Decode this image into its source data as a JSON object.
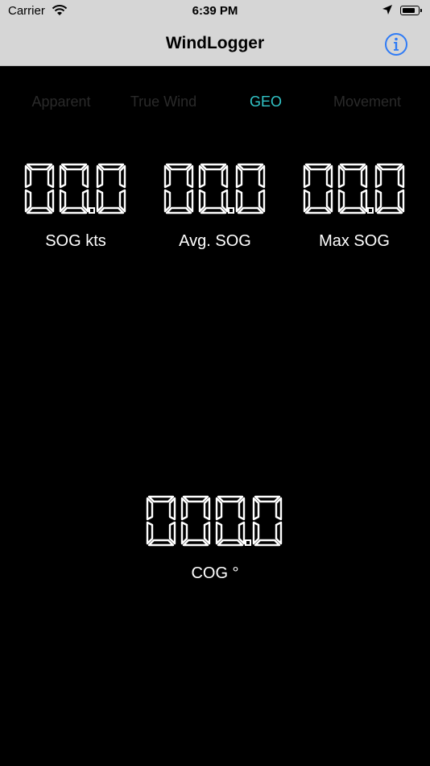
{
  "status_bar": {
    "carrier": "Carrier",
    "time": "6:39 PM",
    "battery_level": 0.85
  },
  "nav": {
    "title": "WindLogger",
    "info_icon": "info-circle-icon",
    "accent_color": "#2f7bf5"
  },
  "tabs": [
    {
      "label": "Apparent",
      "active": false
    },
    {
      "label": "True Wind",
      "active": false
    },
    {
      "label": "GEO",
      "active": true
    },
    {
      "label": "Movement",
      "active": false
    }
  ],
  "readouts": {
    "sog": {
      "value": "00.0",
      "label": "SOG kts"
    },
    "avg_sog": {
      "value": "00.0",
      "label": "Avg. SOG"
    },
    "max_sog": {
      "value": "00.0",
      "label": "Max SOG"
    },
    "cog": {
      "value": "000.0",
      "label": "COG °"
    }
  },
  "colors": {
    "background": "#000000",
    "tab_active": "#32c5c8",
    "tab_inactive": "#2a2a2a",
    "digits": "#ffffff"
  }
}
